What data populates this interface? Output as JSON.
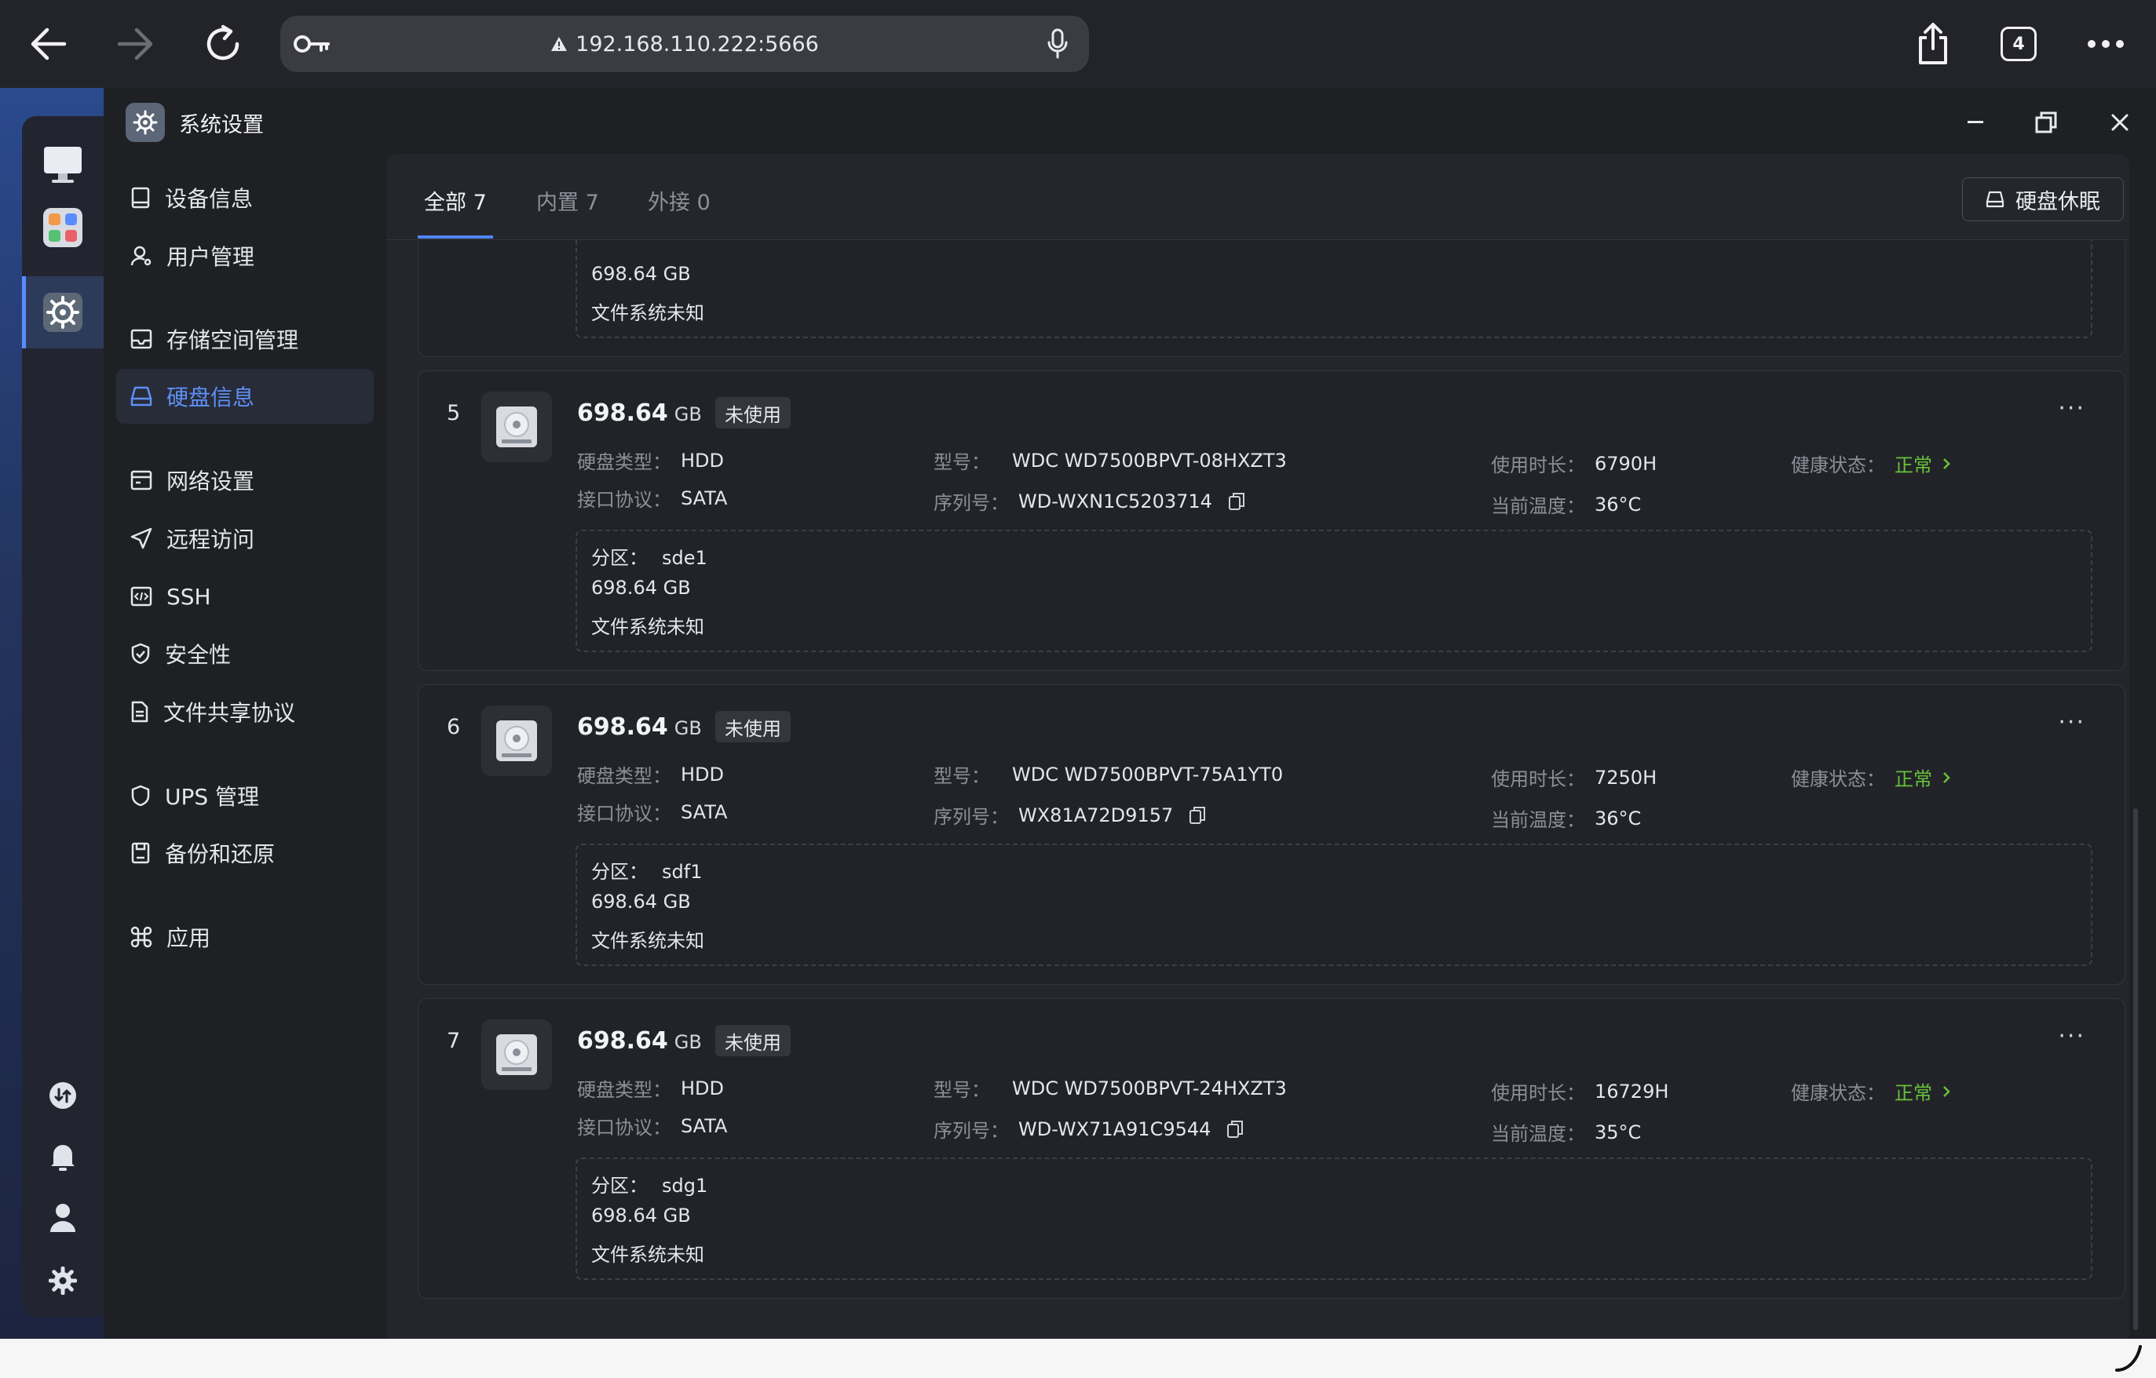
{
  "browser": {
    "url": "192.168.110.222:5666",
    "tab_count": "4"
  },
  "window": {
    "title": "系统设置"
  },
  "sidebar": {
    "items": [
      {
        "label": "设备信息"
      },
      {
        "label": "用户管理"
      },
      {
        "label": "存储空间管理"
      },
      {
        "label": "硬盘信息"
      },
      {
        "label": "网络设置"
      },
      {
        "label": "远程访问"
      },
      {
        "label": "SSH"
      },
      {
        "label": "安全性"
      },
      {
        "label": "文件共享协议"
      },
      {
        "label": "UPS 管理"
      },
      {
        "label": "备份和还原"
      },
      {
        "label": "应用"
      }
    ],
    "active_item": "硬盘信息"
  },
  "tabs": [
    {
      "label": "全部 7"
    },
    {
      "label": "内置 7"
    },
    {
      "label": "外接 0"
    }
  ],
  "sleep_button": "硬盘休眠",
  "labels": {
    "disk_type": "硬盘类型：",
    "interface": "接口协议：",
    "model": "型号：",
    "serial": "序列号：",
    "uptime": "使用时长：",
    "temperature": "当前温度：",
    "health": "健康状态：",
    "partition": "分区：",
    "unit": "GB",
    "more": "···"
  },
  "partial_card": {
    "size": "698.64 GB",
    "fs": "文件系统未知"
  },
  "disks": [
    {
      "index": "5",
      "size": "698.64",
      "status": "未使用",
      "type": "HDD",
      "interface": "SATA",
      "model": "WDC WD7500BPVT-08HXZT3",
      "serial": "WD-WXN1C5203714",
      "uptime": "6790H",
      "temperature": "36°C",
      "health": "正常",
      "partition": "sde1",
      "partition_size": "698.64 GB",
      "fs": "文件系统未知"
    },
    {
      "index": "6",
      "size": "698.64",
      "status": "未使用",
      "type": "HDD",
      "interface": "SATA",
      "model": "WDC WD7500BPVT-75A1YT0",
      "serial": "WX81A72D9157",
      "uptime": "7250H",
      "temperature": "36°C",
      "health": "正常",
      "partition": "sdf1",
      "partition_size": "698.64 GB",
      "fs": "文件系统未知"
    },
    {
      "index": "7",
      "size": "698.64",
      "status": "未使用",
      "type": "HDD",
      "interface": "SATA",
      "model": "WDC WD7500BPVT-24HXZT3",
      "serial": "WD-WX71A91C9544",
      "uptime": "16729H",
      "temperature": "35°C",
      "health": "正常",
      "partition": "sdg1",
      "partition_size": "698.64 GB",
      "fs": "文件系统未知"
    }
  ],
  "colors": {
    "accent": "#4f86f7",
    "health_ok": "#67c23a"
  }
}
